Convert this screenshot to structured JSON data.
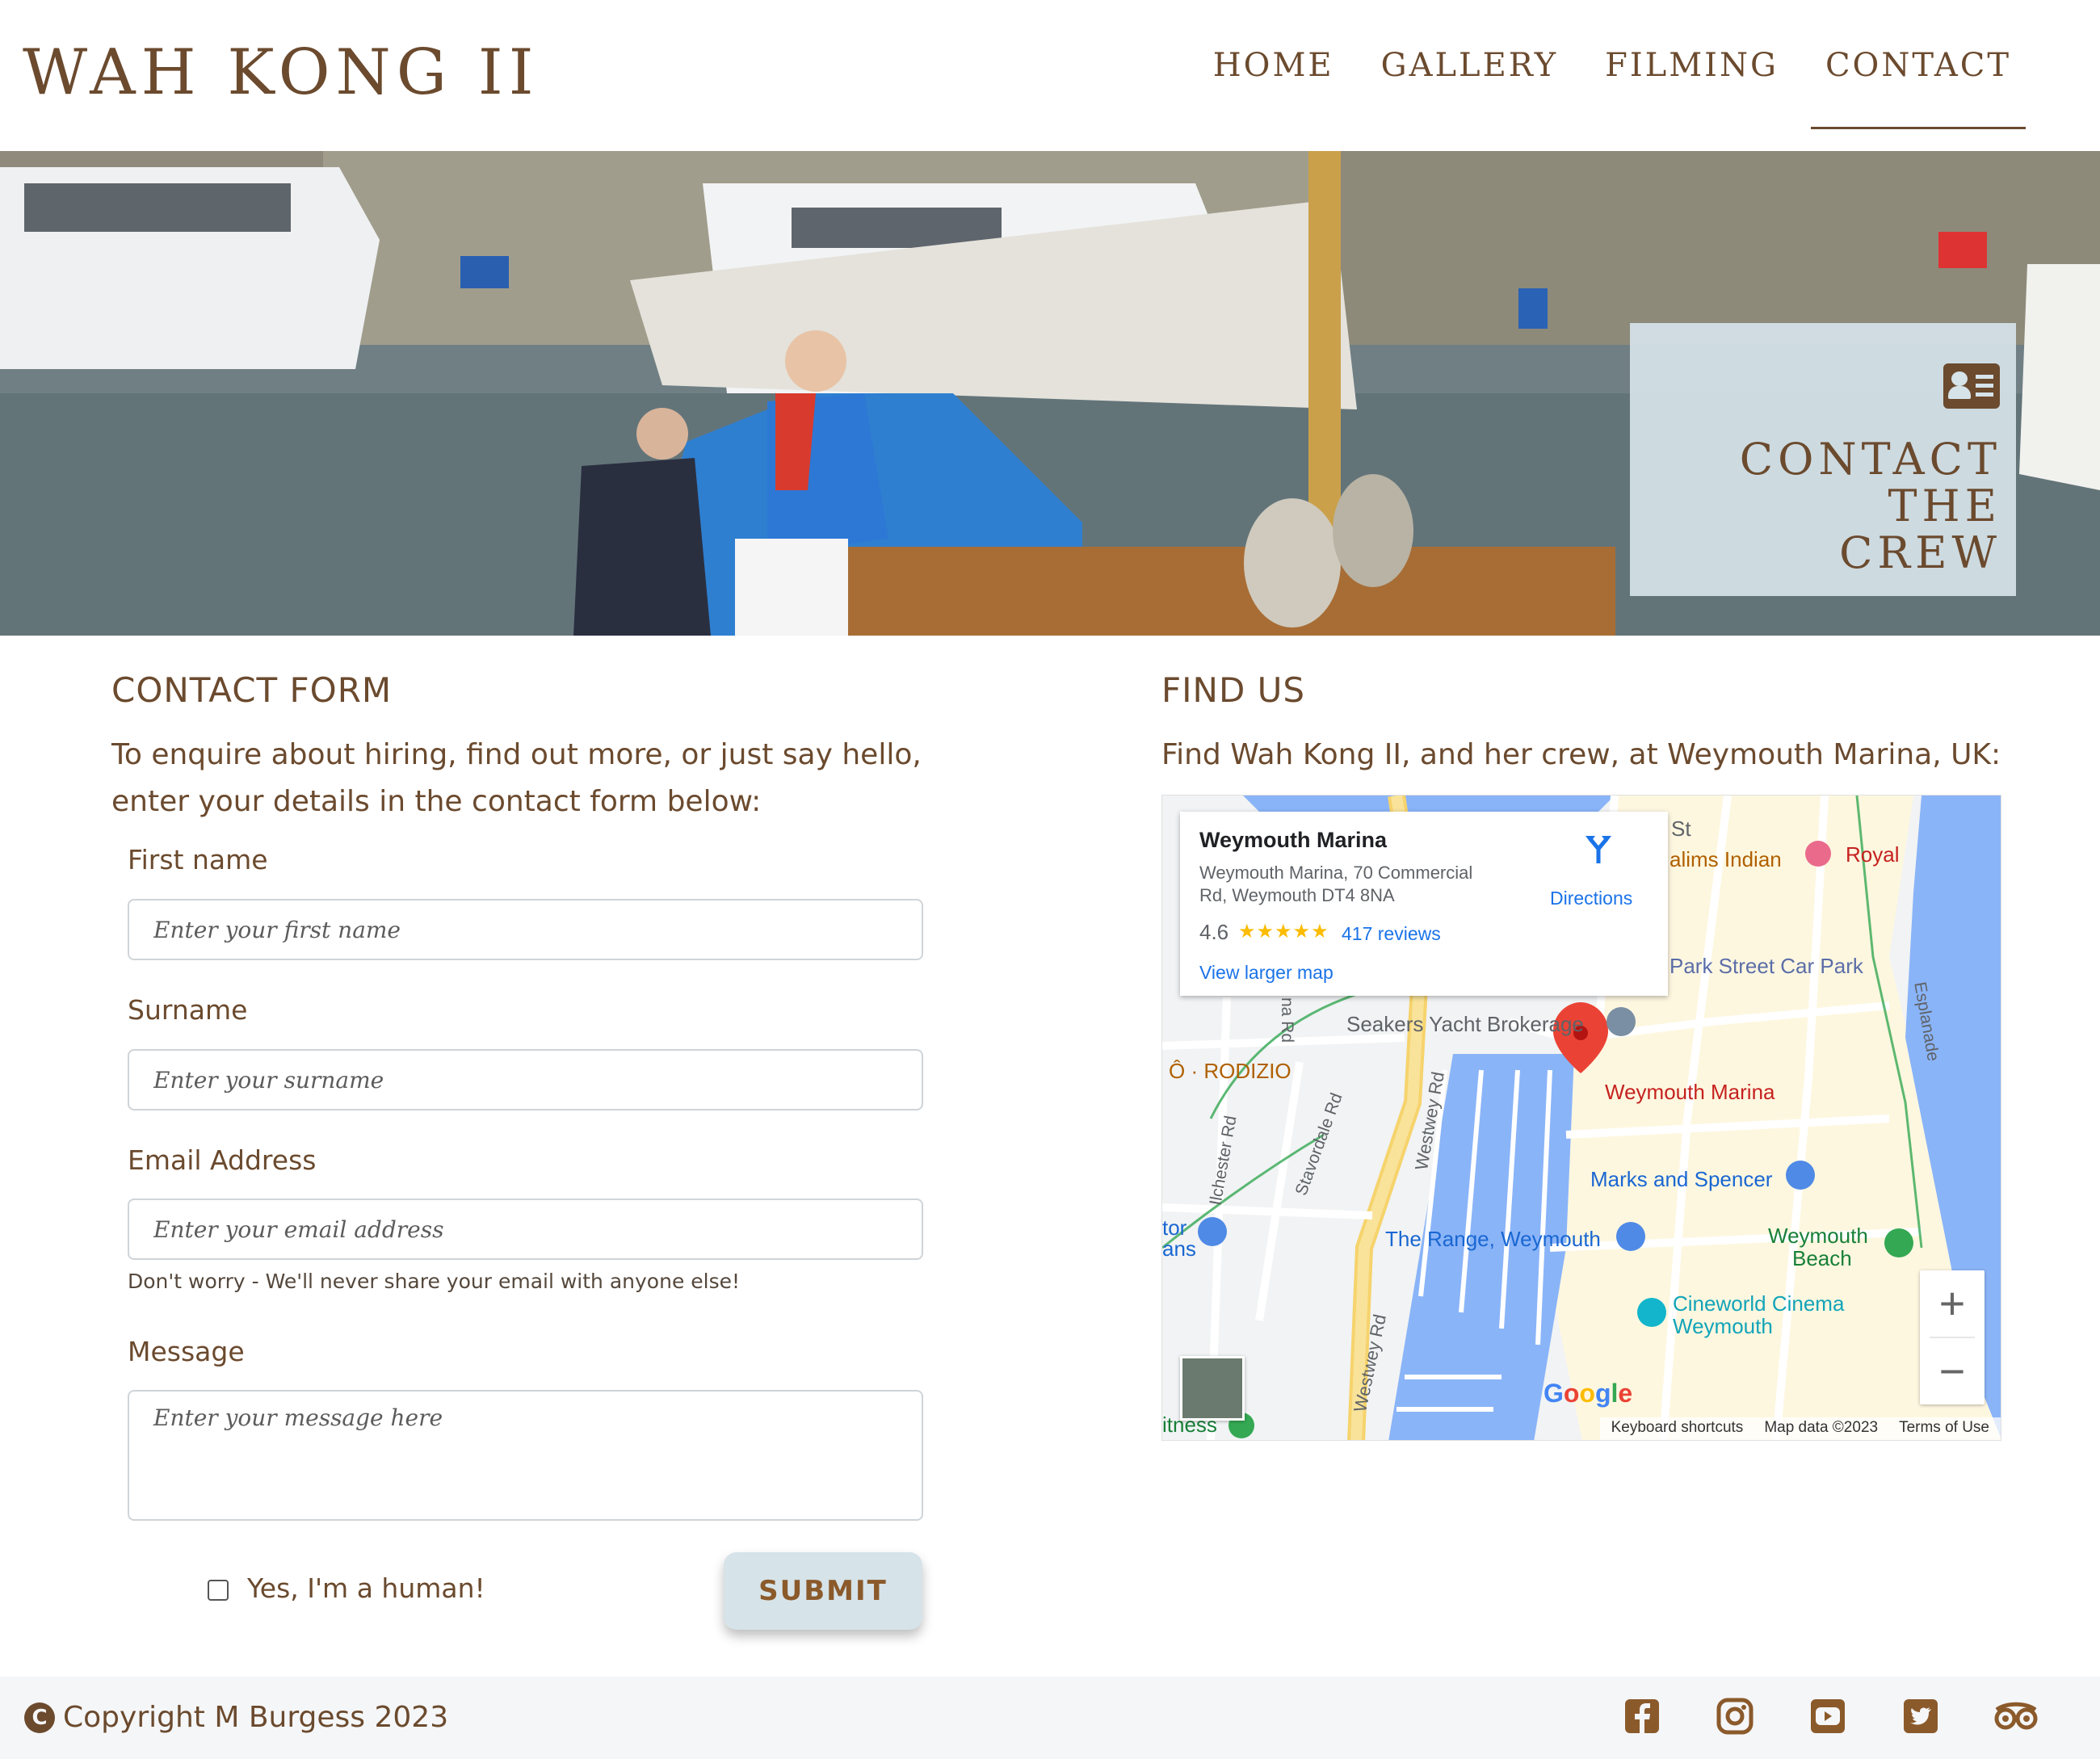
{
  "site": {
    "brand": "WAH KONG II",
    "nav": [
      {
        "label": "HOME"
      },
      {
        "label": "GALLERY"
      },
      {
        "label": "FILMING"
      },
      {
        "label": "CONTACT",
        "active": true
      }
    ]
  },
  "hero": {
    "title_line1": "CONTACT THE",
    "title_line2": "CREW",
    "icon": "address-card-icon"
  },
  "contact_form": {
    "heading": "CONTACT FORM",
    "intro_line1": "To enquire about hiring, find out more, or just say hello,",
    "intro_line2": "enter your details in the contact form below:",
    "first_name_label": "First name",
    "first_name_placeholder": "Enter your first name",
    "surname_label": "Surname",
    "surname_placeholder": "Enter your surname",
    "email_label": "Email Address",
    "email_placeholder": "Enter your email address",
    "email_help": "Don't worry - We'll never share your email with anyone else!",
    "message_label": "Message",
    "message_placeholder": "Enter your message here",
    "human_label": "Yes, I'm a human!",
    "human_checked": false,
    "submit_label": "SUBMIT"
  },
  "find_us": {
    "heading": "FIND US",
    "intro": "Find Wah Kong II, and her crew, at Weymouth Marina, UK:",
    "map": {
      "place_name": "Weymouth Marina",
      "address_line1": "Weymouth Marina, 70 Commercial",
      "address_line2": "Rd, Weymouth DT4 8NA",
      "rating": "4.6",
      "stars": "★★★★★",
      "reviews": "417 reviews",
      "view_larger": "View larger map",
      "directions": "Directions",
      "labels": {
        "st": "St",
        "indian": "alims Indian",
        "royal": "Royal",
        "car_park": "Park Street Car Park",
        "seakers": "Seakers Yacht Brokerage",
        "rodizio": "Ô · RODIZIO",
        "na_rd": "na Rd",
        "ilchester": "Ilchester Rd",
        "stavordale": "Stavordale Rd",
        "westwey_upper": "Westwey Rd",
        "westwey_lower": "Westwey Rd",
        "esplanade": "Esplanade",
        "marina_pin": "Weymouth Marina",
        "marks": "Marks and Spencer",
        "range": "The Range, Weymouth",
        "beach_1": "Weymouth",
        "beach_2": "Beach",
        "cineworld_1": "Cineworld Cinema",
        "cineworld_2": "Weymouth",
        "tor": "tor",
        "ans": "ans",
        "itness": "itness"
      },
      "zoom_in": "+",
      "zoom_out": "−",
      "google": "Google",
      "footer_shortcuts": "Keyboard shortcuts",
      "footer_data": "Map data ©2023",
      "footer_terms": "Terms of Use",
      "colors": {
        "water": "#8ab4f8",
        "land": "#f1f3f4",
        "beach": "#fef7e0",
        "pin": "#ea4335",
        "link": "#1a73e8"
      }
    }
  },
  "footer": {
    "copyright_icon": "C",
    "copyright": "Copyright M Burgess 2023",
    "social": [
      "facebook-icon",
      "instagram-icon",
      "youtube-icon",
      "twitter-icon",
      "tripadvisor-icon"
    ]
  },
  "colors": {
    "brand": "#6b4a2e",
    "button_bg": "#d6e3e9",
    "footer_bg": "#f5f6f8"
  }
}
